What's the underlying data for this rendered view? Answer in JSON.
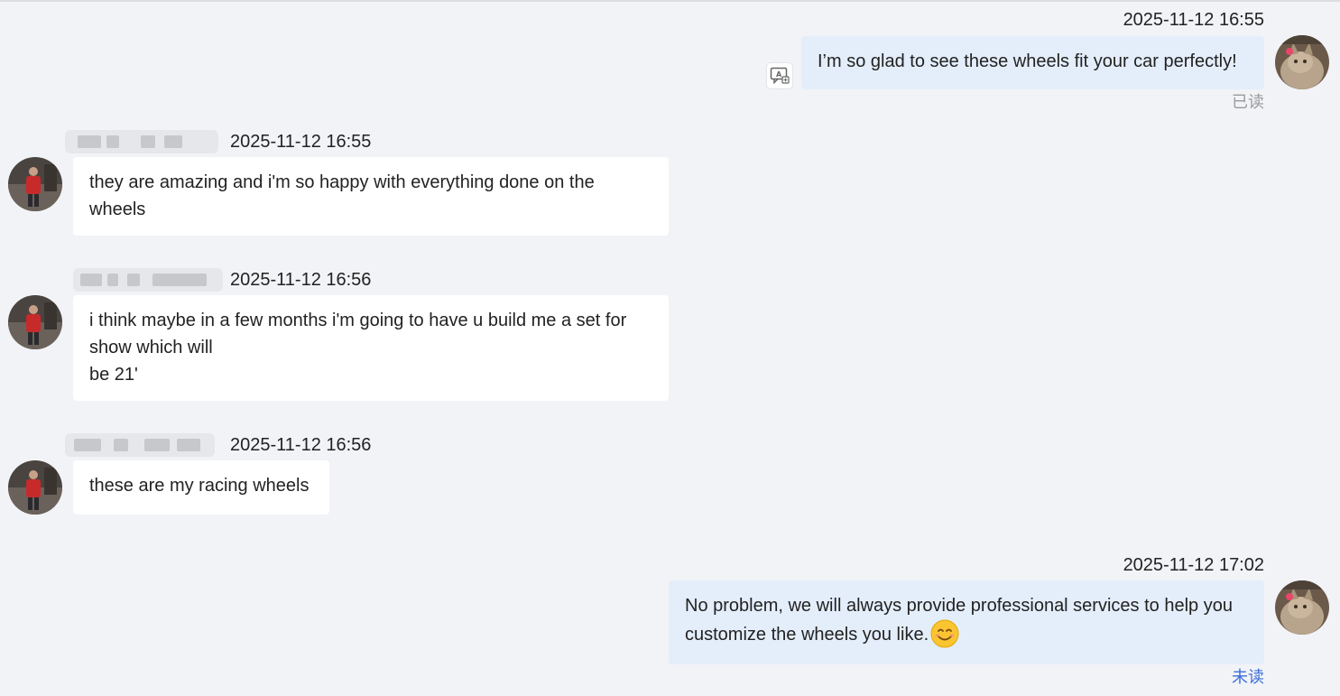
{
  "messages": [
    {
      "side": "outgoing",
      "timestamp": "2025-11-12 16:55",
      "lines": [
        "I’m so glad to see these wheels fit your car perfectly!"
      ],
      "status": "已读",
      "translate_icon": "translate-icon"
    },
    {
      "side": "incoming",
      "timestamp": "2025-11-12 16:55",
      "lines": [
        "they are amazing and i'm so happy with everything done on the",
        "wheels"
      ]
    },
    {
      "side": "incoming",
      "timestamp": "2025-11-12 16:56",
      "lines": [
        "i think maybe in a few months i'm going to have u build me a set for",
        "show which will",
        "be 21'"
      ]
    },
    {
      "side": "incoming",
      "timestamp": "2025-11-12 16:56",
      "lines": [
        "these are my racing wheels"
      ]
    },
    {
      "side": "outgoing",
      "timestamp": "2025-11-12 17:02",
      "lines": [
        "No problem, we will always provide professional services to help you",
        "customize the wheels you like."
      ],
      "emoji": "smiling-face-emoji",
      "status": "未读"
    }
  ],
  "colors": {
    "background": "#f2f3f7",
    "incoming_bubble": "#ffffff",
    "outgoing_bubble": "#e4eefb",
    "read_status": "#9a9a9a",
    "unread_status": "#3a6fd8"
  }
}
